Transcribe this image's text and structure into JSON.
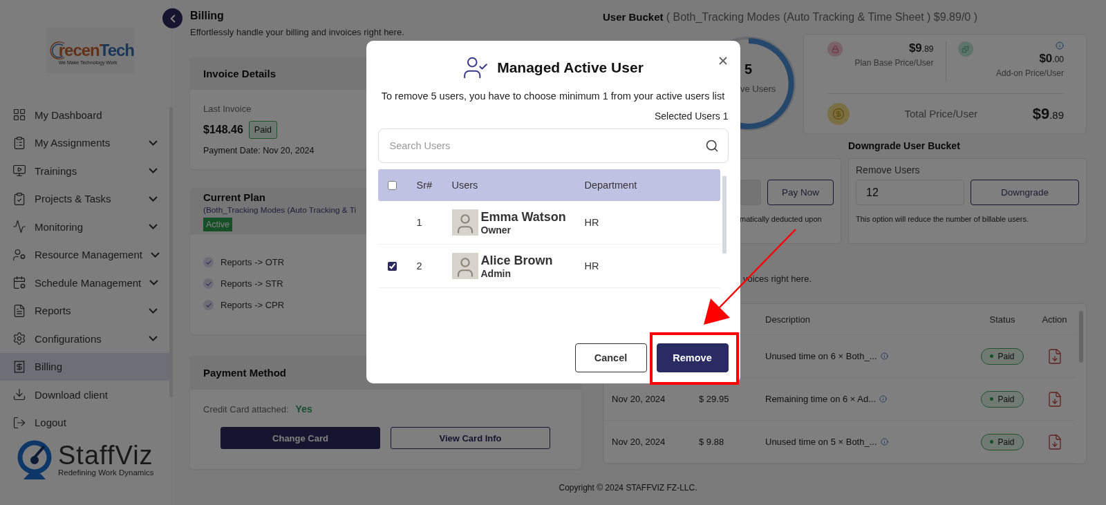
{
  "sidebar": {
    "logo": {
      "wordmark": "recenTech",
      "tagline": "We Make Technology Work"
    },
    "items": [
      {
        "label": "My Dashboard",
        "expandable": false,
        "selected": false
      },
      {
        "label": "My Assignments",
        "expandable": true,
        "selected": false
      },
      {
        "label": "Trainings",
        "expandable": true,
        "selected": false
      },
      {
        "label": "Projects & Tasks",
        "expandable": true,
        "selected": false
      },
      {
        "label": "Monitoring",
        "expandable": true,
        "selected": false
      },
      {
        "label": "Resource Management",
        "expandable": true,
        "selected": false
      },
      {
        "label": "Schedule Management",
        "expandable": true,
        "selected": false
      },
      {
        "label": "Reports",
        "expandable": true,
        "selected": false
      },
      {
        "label": "Configurations",
        "expandable": true,
        "selected": false
      },
      {
        "label": "Billing",
        "expandable": false,
        "selected": true
      },
      {
        "label": "Download client",
        "expandable": false,
        "selected": false
      },
      {
        "label": "Logout",
        "expandable": false,
        "selected": false
      }
    ],
    "brand": {
      "name": "StaffViz",
      "tagline": "Redefining Work Dynamics"
    }
  },
  "page": {
    "title": "Billing",
    "subtitle": "Effortlessly handle your billing and invoices right here."
  },
  "invoice_details": {
    "title": "Invoice Details",
    "last_invoice_label": "Last Invoice",
    "amount": "$148.46",
    "status": "Paid",
    "payment_date": "Payment Date: Nov 20, 2024"
  },
  "current_plan": {
    "title": "Current Plan",
    "plan_name": "(Both_Tracking Modes (Auto Tracking & Ti",
    "status": "Active",
    "features": [
      {
        "label": "Reports -> OTR",
        "checked": true
      },
      {
        "label": "Reports -> STR",
        "checked": true
      },
      {
        "label": "Reports -> CPR",
        "checked": true
      }
    ]
  },
  "payment_method": {
    "title": "Payment Method",
    "card_label": "Credit Card attached:",
    "card_value": "Yes",
    "buttons": [
      {
        "label": "Change Card",
        "kind": "primary"
      },
      {
        "label": "View Card Info",
        "kind": "outline"
      }
    ]
  },
  "user_bucket": {
    "label": "User Bucket",
    "plan": "( Both_Tracking Modes (Auto Tracking & Time Sheet ) $9.89/0 )",
    "active_count": "5",
    "active_label": "ve Users",
    "prices": {
      "base_price": "$9.89",
      "base_label": "Plan Base Price/User",
      "addon_price": "$0.00",
      "addon_label": "Add-on Price/User",
      "total_label": "Total Price/User",
      "total_price": "$9.89"
    }
  },
  "upgrade": {
    "button": "Pay Now",
    "note": "matically deducted upon"
  },
  "downgrade": {
    "title": "Downgrade User Bucket",
    "field_label": "Remove Users",
    "field_value": "12",
    "button": "Downgrade",
    "note": "This option will reduce the number of billable users."
  },
  "invoices": {
    "intro": "voices right here.",
    "columns": [
      "Description",
      "Status",
      "Action"
    ],
    "rows": [
      {
        "description": "Unused time on 6 × Both_...",
        "status": "Paid"
      },
      {
        "date": "Nov 20, 2024",
        "amount": "$ 29.95",
        "description": "Remaining time on 6 × Ad...",
        "status": "Paid"
      },
      {
        "date": "Nov 20, 2024",
        "amount": "$ 9.88",
        "description": "Unused time on 5 × Both_...",
        "status": "Paid"
      }
    ]
  },
  "footer": "Copyright © 2024 STAFFVIZ FZ-LLC.",
  "modal": {
    "title": "Managed Active User",
    "message": "To remove 5 users, you have to choose minimum 1 from your active users list",
    "selected_count": "Selected Users 1",
    "search_placeholder": "Search Users",
    "columns": [
      "Sr#",
      "Users",
      "Department"
    ],
    "all_checked": false,
    "rows": [
      {
        "kind": "locked",
        "sr": "1",
        "name": "Emma Watson",
        "role": "Owner",
        "department": "HR"
      },
      {
        "kind": "selectable",
        "checked": true,
        "sr": "2",
        "name": "Alice Brown",
        "role": "Admin",
        "department": "HR"
      }
    ],
    "buttons": [
      {
        "label": "Cancel",
        "kind": "outline"
      },
      {
        "label": "Remove",
        "kind": "primary"
      }
    ]
  }
}
